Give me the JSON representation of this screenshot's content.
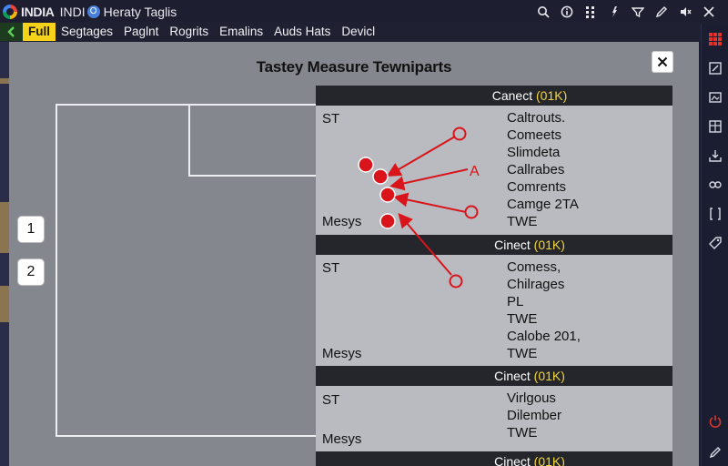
{
  "titlebar": {
    "app_name": "INDIA",
    "app_secondary": "INDI",
    "badge_glyph": "O",
    "window_title": "Heraty Taglis",
    "icons": [
      "search-icon",
      "info-icon",
      "grid-icon",
      "pin-icon",
      "filter-icon",
      "edit-icon",
      "mute-icon",
      "close-icon"
    ]
  },
  "menubar": {
    "items": [
      "Full",
      "Segtages",
      "Paglnt",
      "Rogrits",
      "Emalins",
      "Auds Hats",
      "Devicl"
    ]
  },
  "dialog": {
    "title": "Tastey Measure Tewniparts",
    "close_label": "×",
    "buttons": [
      "1",
      "2"
    ]
  },
  "data_panel": {
    "groups": [
      {
        "header": "Canect",
        "header_note": "(01K)",
        "left_top": "ST",
        "left_bottom": "Mesys",
        "right": [
          "Caltrouts.",
          "Comeets",
          "Slimdeta",
          "Callrabes",
          "Comrents",
          "Camge 2TA",
          "TWE"
        ]
      },
      {
        "header": "Cinect",
        "header_note": "(01K)",
        "left_top": "ST",
        "left_bottom": "Mesys",
        "right": [
          "Comess,",
          "Chilrages",
          "PL",
          "TWE",
          "Calobe 201,",
          "TWE"
        ]
      },
      {
        "header": "Cinect",
        "header_note": "(01K)",
        "left_top": "ST",
        "left_bottom": "Mesys",
        "right": [
          "Virlgous",
          "Dilember",
          "TWE"
        ]
      },
      {
        "header": "Cinect",
        "header_note": "(01K)"
      }
    ]
  },
  "annotation": {
    "letter": "A"
  },
  "colors": {
    "accent_yellow": "#f7d21a",
    "marker_red": "#d9141b",
    "dialog_gray": "#85878e",
    "panel_gray": "#b9bbc1",
    "header_dark": "#25262c"
  }
}
